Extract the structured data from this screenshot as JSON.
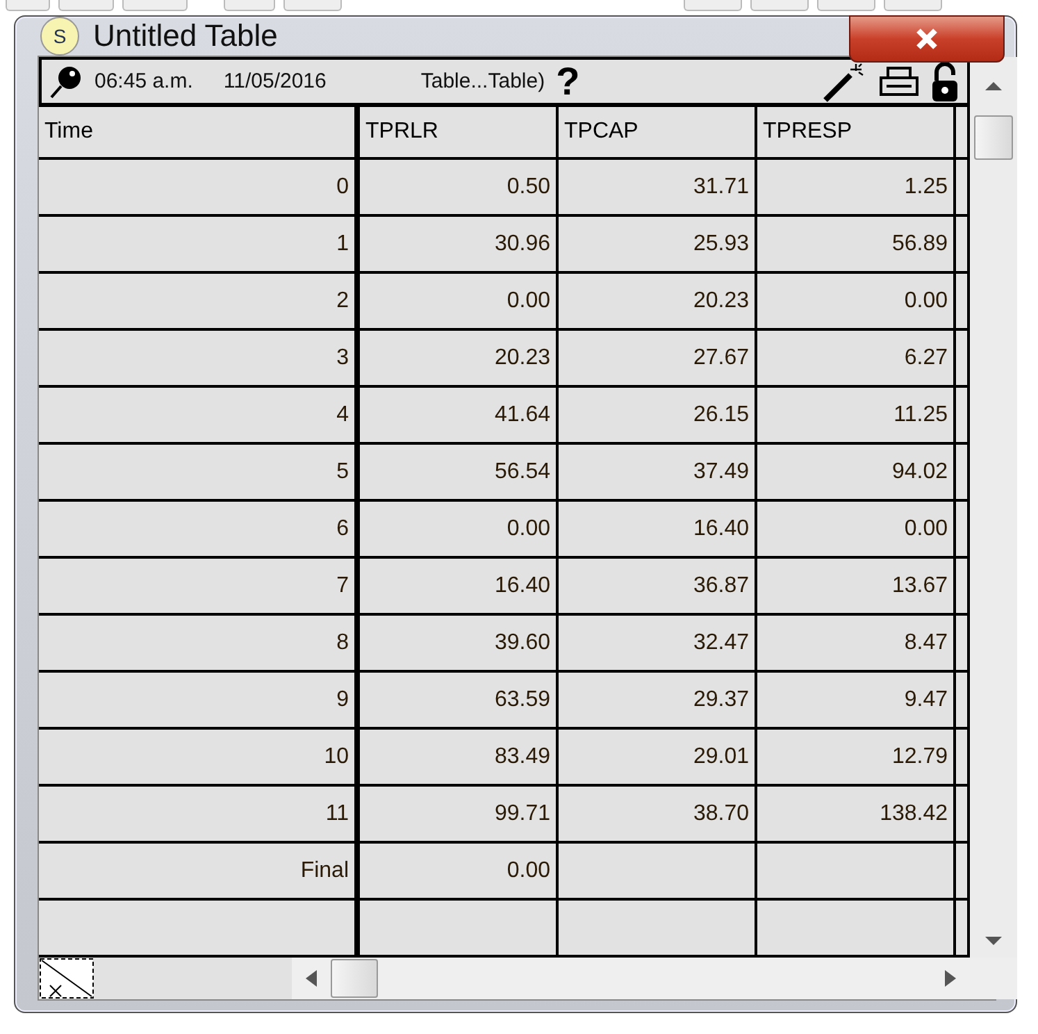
{
  "window": {
    "title": "Untitled Table",
    "app_letter": "S"
  },
  "toolbar": {
    "time": "06:45 a.m.",
    "date": "11/05/2016",
    "table_label": "Table...Table)",
    "help": "?"
  },
  "table": {
    "columns": [
      "Time",
      "TPRLR",
      "TPCAP",
      "TPRESP"
    ],
    "rows": [
      [
        "0",
        "0.50",
        "31.71",
        "1.25"
      ],
      [
        "1",
        "30.96",
        "25.93",
        "56.89"
      ],
      [
        "2",
        "0.00",
        "20.23",
        "0.00"
      ],
      [
        "3",
        "20.23",
        "27.67",
        "6.27"
      ],
      [
        "4",
        "41.64",
        "26.15",
        "11.25"
      ],
      [
        "5",
        "56.54",
        "37.49",
        "94.02"
      ],
      [
        "6",
        "0.00",
        "16.40",
        "0.00"
      ],
      [
        "7",
        "16.40",
        "36.87",
        "13.67"
      ],
      [
        "8",
        "39.60",
        "32.47",
        "8.47"
      ],
      [
        "9",
        "63.59",
        "29.37",
        "9.47"
      ],
      [
        "10",
        "83.49",
        "29.01",
        "12.79"
      ],
      [
        "11",
        "99.71",
        "38.70",
        "138.42"
      ],
      [
        "Final",
        "0.00",
        "",
        ""
      ]
    ]
  }
}
